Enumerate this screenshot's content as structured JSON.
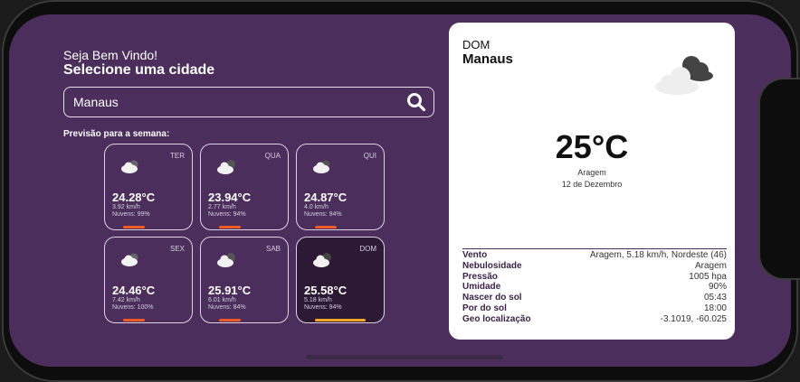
{
  "header": {
    "greeting": "Seja Bem Vindo!",
    "subtitle": "Selecione uma cidade"
  },
  "search": {
    "value": "Manaus",
    "icon": "search-icon"
  },
  "forecast": {
    "label": "Previsão para a semana:",
    "days": [
      {
        "day": "TER",
        "temp": "24.28°C",
        "wind": "3.92 km/h",
        "clouds": "Nuvens: 99%",
        "icon": "cloud-icon"
      },
      {
        "day": "QUA",
        "temp": "23.94°C",
        "wind": "2.77 km/h",
        "clouds": "Nuvens: 94%",
        "icon": "cloud-icon"
      },
      {
        "day": "QUI",
        "temp": "24.87°C",
        "wind": "4.0 km/h",
        "clouds": "Nuvens: 94%",
        "icon": "cloud-icon"
      },
      {
        "day": "SEX",
        "temp": "24.46°C",
        "wind": "7.42 km/h",
        "clouds": "Nuvens: 100%",
        "icon": "cloud-icon"
      },
      {
        "day": "SAB",
        "temp": "25.91°C",
        "wind": "6.01 km/h",
        "clouds": "Nuvens: 84%",
        "icon": "cloud-icon"
      },
      {
        "day": "DOM",
        "temp": "25.58°C",
        "wind": "5.18 km/h",
        "clouds": "Nuvens: 94%",
        "icon": "cloud-icon"
      }
    ],
    "active_day": "DOM"
  },
  "current": {
    "day": "DOM",
    "city": "Manaus",
    "temp": "25°C",
    "description": "Aragem",
    "date": "12 de Dezembro",
    "icon": "cloud-icon",
    "details": [
      {
        "label": "Vento",
        "value": "Aragem, 5.18 km/h, Nordeste (46)"
      },
      {
        "label": "Nebulosidade",
        "value": "Aragem"
      },
      {
        "label": "Pressão",
        "value": "1005 hpa"
      },
      {
        "label": "Umidade",
        "value": "90%"
      },
      {
        "label": "Nascer do sol",
        "value": "05:43"
      },
      {
        "label": "Por do sol",
        "value": "18:00"
      },
      {
        "label": "Geo localização",
        "value": "-3.1019, -60.025"
      }
    ]
  },
  "colors": {
    "background": "#4b2e5c",
    "card": "#ffffff",
    "accent_bar": "#f05a24",
    "active_bar": "#f5a623"
  }
}
